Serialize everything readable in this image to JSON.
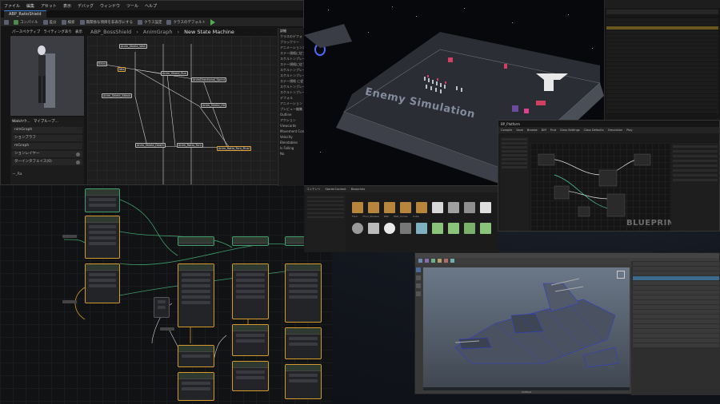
{
  "anim_blueprint": {
    "menu": [
      "ファイル",
      "編集",
      "アセット",
      "表示",
      "デバッグ",
      "ウィンドウ",
      "ツール",
      "ヘルプ"
    ],
    "tab_title": "ABP_RatioShield",
    "toolbar": {
      "compile": "コンパイル",
      "diff": "差分",
      "find": "検索",
      "hide_unrelated": "無関係な項目を非表示にする",
      "class_settings": "クラス設定",
      "class_defaults": "クラスのデフォルト",
      "save": "保存"
    },
    "viewport_tabs": [
      "パースペクティブ",
      "ライティングあり",
      "表示"
    ],
    "breadcrumb": [
      "ABP_BossShield",
      "AnimGraph",
      "New State Machine"
    ],
    "watch_panel": {
      "tabs": [
        "Watchウ...",
        "マイブループ..."
      ],
      "rows": [
        "nimGraph",
        "ションブラフ",
        "mGraph",
        "ションレイヤー",
        "タ―インタフェイス(0)"
      ],
      "footer": "ー_Ra"
    },
    "details_panel": {
      "tab": "詳細",
      "rows": [
        "クラスのデフォ",
        "ブラックリー",
        "アニメーションステー",
        "ステー規格に従う",
        "スケルトンプレーブ",
        "ステー規格に従う",
        "スケルトンプレーブ",
        "スケルトンブレーブ",
        "ステー規格 に従う",
        "スケルトンブレーブ",
        "スケルトンブレーブ",
        "デフォル",
        "アニメーション",
        "プレビュー編集",
        "Outline",
        "アクション",
        "Viewcards",
        "Movement Config",
        "Velocity",
        "Blendables",
        "Is Falling"
      ],
      "badge": "No"
    },
    "graph_nodes": [
      "Entry",
      "Idle",
      "Anim_Shield_Run",
      "AnimDirectional_Sprint",
      "Anim_Shield_Attack",
      "Anim_Shield_Hit",
      "Anim_Shield_Death",
      "Anim_Ratio_Turn",
      "Anim_Shield_Wall",
      "Anim_Shield_End",
      "Anim_Shield_Blend",
      "Anim_Shield_Pivot",
      "Anim_Ratio_Turn_Final"
    ]
  },
  "level_viewport": {
    "overlay_text": "Enemy Simulation"
  },
  "blueprint_window": {
    "watermark": "BLUEPRINT",
    "tab": "BP_Platform",
    "toolbar": [
      "Compile",
      "Save",
      "Browse",
      "Diff",
      "Find",
      "Class Settings",
      "Class Defaults",
      "Simulation",
      "Play"
    ]
  },
  "content_browser": {
    "tabs": [
      "コンテンツ",
      "StarterContent",
      "Blueprints"
    ],
    "assets": [
      "Floor",
      "Floor_Shaded",
      "Wall",
      "Wall_Corner",
      "Cube",
      "Cylinder",
      "Sphere",
      "Mesh"
    ]
  },
  "maya": {
    "status": "Untitled"
  },
  "colors": {
    "selection_orange": "#d59a2c",
    "selection_green": "#3fa06b",
    "accent_blue": "#3b7ddd",
    "enemy_red": "#d04060",
    "ship_body": "#444c5c"
  }
}
